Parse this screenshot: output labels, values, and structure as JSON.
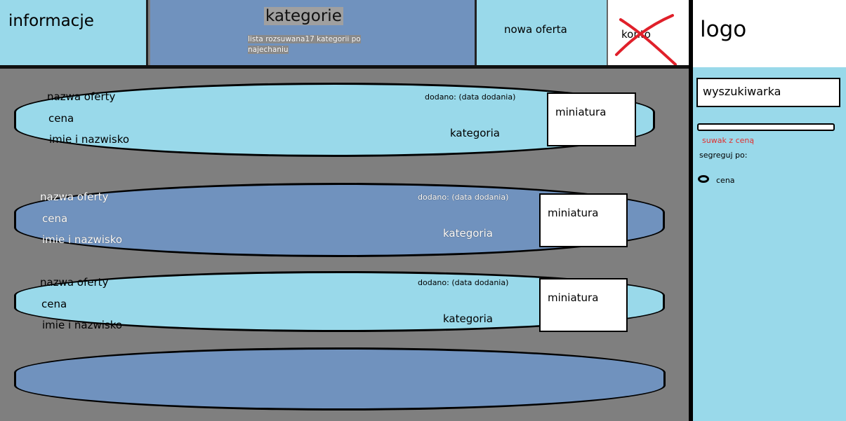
{
  "header": {
    "info": "informacje",
    "categories_title": "kategorie",
    "categories_note": "lista rozsuwana17 kategorii po najechaniu",
    "new_offer": "nowa oferta",
    "account": "konto",
    "logo": "logo"
  },
  "sidebar": {
    "search": "wyszukiwarka",
    "price_slider": "suwak z ceną",
    "sort_by": "segreguj po:",
    "sort_option": "cena"
  },
  "offers": [
    {
      "name": "nazwa oferty",
      "price": "cena",
      "person": "imie i nazwisko",
      "added": "dodano: (data dodania)",
      "category": "kategoria",
      "thumb": "miniatura"
    },
    {
      "name": "nazwa oferty",
      "price": "cena",
      "person": "imie i nazwisko",
      "added": "dodano: (data dodania)",
      "category": "kategoria",
      "thumb": "miniatura"
    },
    {
      "name": "nazwa oferty",
      "price": "cena",
      "person": "imie i nazwisko",
      "added": "dodano: (data dodania)",
      "category": "kategoria",
      "thumb": "miniatura"
    }
  ],
  "colors": {
    "light": "#99d9ea",
    "dark": "#7092be",
    "gray": "#7f7f7f",
    "cross": "#e0202a"
  }
}
